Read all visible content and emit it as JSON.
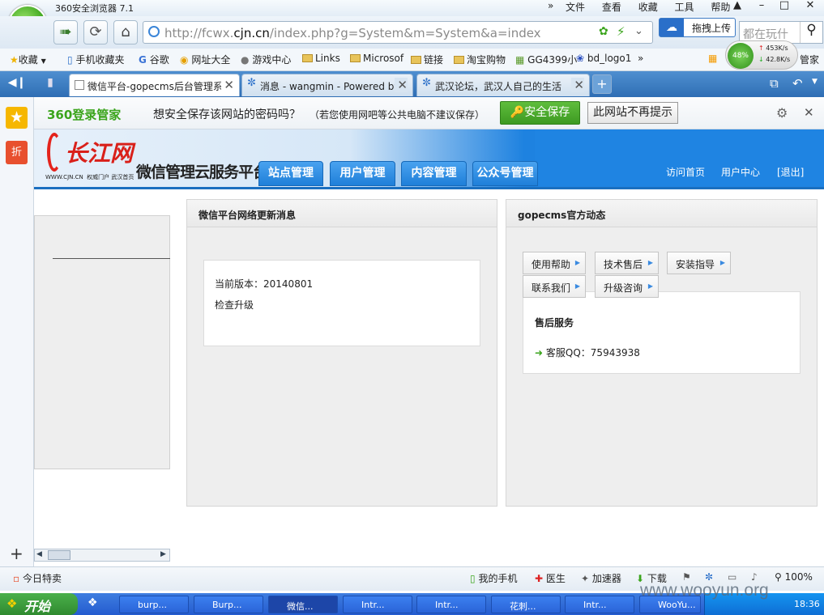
{
  "window": {
    "title": "360安全浏览器 7.1",
    "menus": [
      "文件",
      "查看",
      "收藏",
      "工具",
      "帮助"
    ]
  },
  "nav": {
    "url_prefix": "http://fcwx.",
    "url_domain": "cjn.cn",
    "url_suffix": "/index.php?g=System&m=System&a=index",
    "upload_label": "拖拽上传",
    "search_placeholder": "都在玩什"
  },
  "favorites": {
    "items": [
      "收藏",
      "手机收藏夹",
      "谷歌",
      "网址大全",
      "游戏中心",
      "Links",
      "Microsof",
      "链接",
      "淘宝购物",
      "GG4399小",
      "bd_logo1"
    ],
    "more": "»",
    "right_label": "管家"
  },
  "speed": {
    "percent": "48%",
    "up": "453K/s",
    "down": "42.8K/s"
  },
  "tabs": [
    {
      "label": "微信平台-gopecms后台管理系",
      "active": true
    },
    {
      "label": "消息 - wangmin - Powered by",
      "active": false
    },
    {
      "label": "武汉论坛，武汉人自己的生活",
      "active": false
    }
  ],
  "password_bar": {
    "brand": "360登录管家",
    "question": "想安全保存该网站的密码吗？",
    "hint": "（若您使用网吧等公共电脑不建议保存）",
    "save_label": "安全保存",
    "never_label": "此网站不再提示"
  },
  "site": {
    "logo_text": "长江网",
    "logo_sub": "WWW.CJN.CN  权威门户 武汉首页",
    "platform": "微信管理云服务平台",
    "nav_tabs": [
      "站点管理",
      "用户管理",
      "内容管理",
      "公众号管理"
    ],
    "top_links": [
      "访问首页",
      "用户中心",
      "[退出]"
    ]
  },
  "panel_left": {
    "title": "微信平台网络更新消息",
    "version_label": "当前版本：",
    "version": "20140801",
    "check_update": "检查升级"
  },
  "panel_right": {
    "title": "gopecms官方动态",
    "buttons": [
      "使用帮助",
      "技术售后",
      "安装指导",
      "联系我们",
      "升级咨询"
    ],
    "service_title": "售后服务",
    "qq_label": "客服QQ：",
    "qq": "75943938"
  },
  "status": {
    "left": "今日特卖",
    "items": [
      "我的手机",
      "医生",
      "加速器",
      "下载"
    ],
    "zoom": "100%"
  },
  "taskbar": {
    "start": "开始",
    "tasks": [
      "burp...",
      "Burp...",
      "微信...",
      "Intr...",
      "Intr...",
      "花刺...",
      "Intr...",
      "WooYu..."
    ],
    "clock": "18:36"
  },
  "watermark": "www.wooyun.org"
}
